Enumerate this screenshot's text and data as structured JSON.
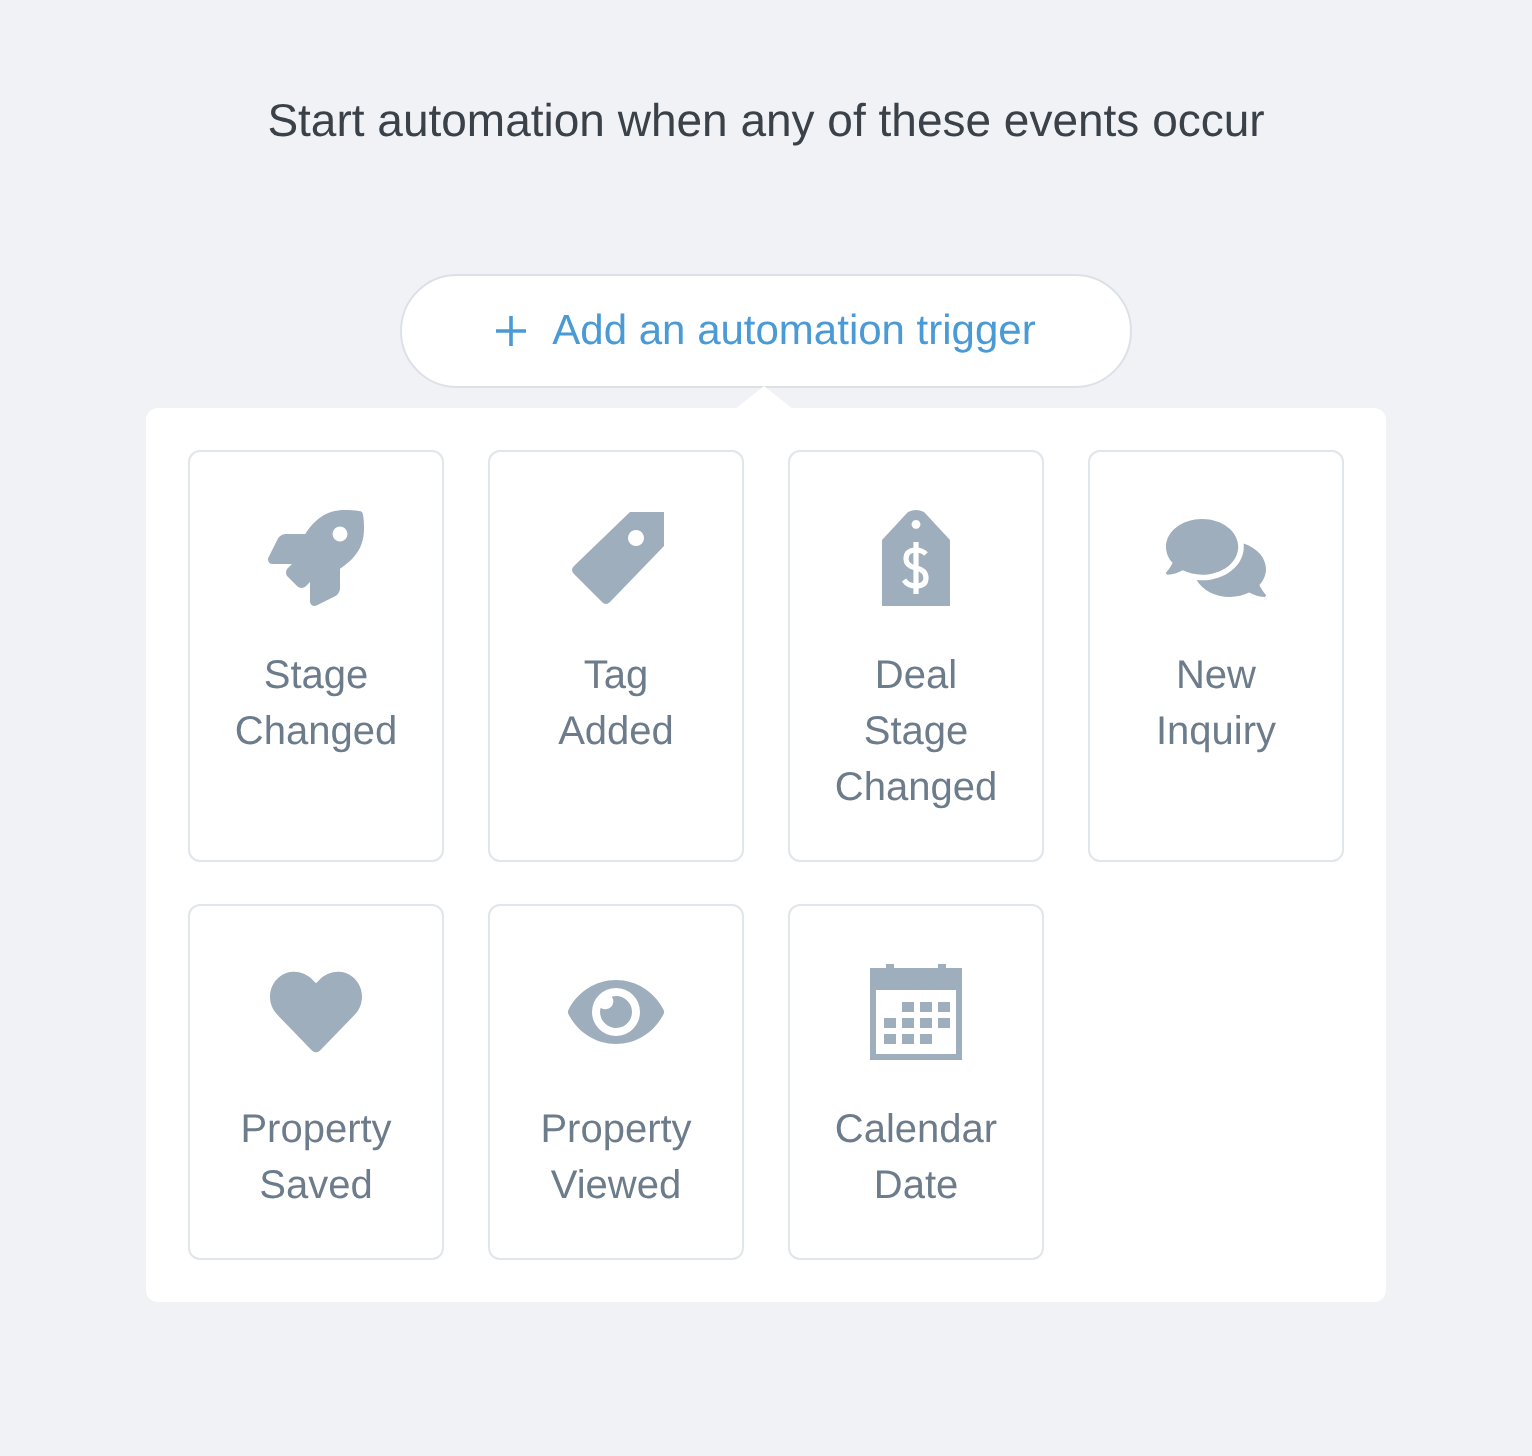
{
  "heading": "Start automation when any of these events occur",
  "add_trigger_button": {
    "label": "Add an automation trigger"
  },
  "triggers": [
    {
      "label": "Stage Changed"
    },
    {
      "label": "Tag Added"
    },
    {
      "label": "Deal Stage Changed"
    },
    {
      "label": "New Inquiry"
    },
    {
      "label": "Property Saved"
    },
    {
      "label": "Property Viewed"
    },
    {
      "label": "Calendar Date"
    }
  ]
}
